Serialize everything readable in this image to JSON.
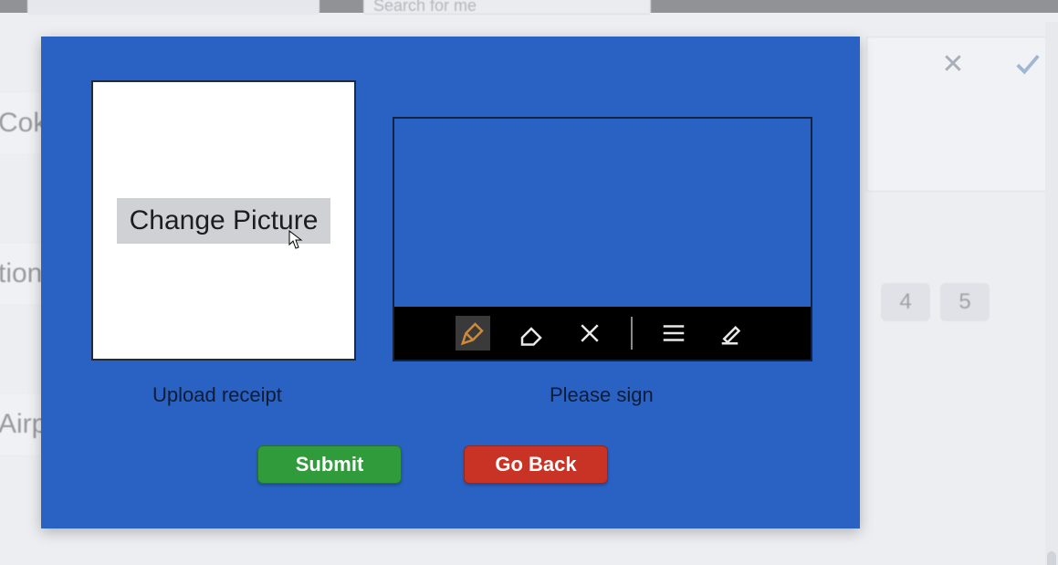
{
  "background": {
    "search_placeholder": "Search for me",
    "rows": [
      "Coke",
      "tion",
      "Airp"
    ],
    "pages": [
      "4",
      "5"
    ]
  },
  "modal": {
    "change_picture_label": "Change Picture",
    "upload_caption": "Upload receipt",
    "sign_caption": "Please sign",
    "submit_label": "Submit",
    "goback_label": "Go Back",
    "ink_tools": {
      "pen": "pen-icon",
      "eraser": "eraser-icon",
      "clear": "clear-icon",
      "lines": "line-weight-icon",
      "write": "handwrite-icon"
    }
  }
}
